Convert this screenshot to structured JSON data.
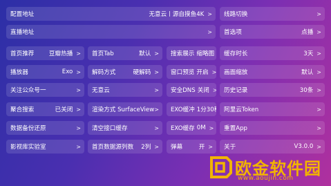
{
  "rows": [
    [
      {
        "name": "config-address",
        "label": "配置地址",
        "value": "无意云丨源自摸鱼4K"
      },
      {
        "name": "line-switch",
        "label": "线路切换",
        "value": ""
      }
    ],
    [
      {
        "name": "live-address",
        "label": "直播地址",
        "value": ""
      },
      {
        "name": "preferences",
        "label": "首选项",
        "value": "点播"
      }
    ],
    [
      {
        "name": "home-recommend",
        "label": "首页推荐",
        "value": "豆瓣热播"
      },
      {
        "name": "home-tab",
        "label": "首页Tab",
        "value": "默认"
      },
      {
        "name": "search-display",
        "label": "搜索展示",
        "value": "缩略图"
      },
      {
        "name": "cache-duration",
        "label": "缓存时长",
        "value": "3天"
      }
    ],
    [
      {
        "name": "player",
        "label": "播放器",
        "value": "Exo"
      },
      {
        "name": "decode-mode",
        "label": "解码方式",
        "value": "硬解码"
      },
      {
        "name": "window-preview",
        "label": "窗口预览",
        "value": "开启"
      },
      {
        "name": "picture-scale",
        "label": "画面缩放",
        "value": "默认"
      }
    ],
    [
      {
        "name": "follow-account",
        "label": "关注公众号一",
        "value": ""
      },
      {
        "name": "wuyiyun",
        "label": "无意云",
        "value": ""
      },
      {
        "name": "secure-dns",
        "label": "安全DNS",
        "value": "关闭"
      },
      {
        "name": "history",
        "label": "历史记录",
        "value": "30条"
      }
    ],
    [
      {
        "name": "aggregate-search",
        "label": "聚合搜索",
        "value": "已关闭"
      },
      {
        "name": "render-mode",
        "label": "渲染方式 SurfaceView",
        "value": ""
      },
      {
        "name": "exo-buffer",
        "label": "EXO缓冲",
        "value": "1分30秒"
      },
      {
        "name": "aliyun-token",
        "label": "阿里云Token",
        "value": ""
      }
    ],
    [
      {
        "name": "data-backup",
        "label": "数据备份还原",
        "value": ""
      },
      {
        "name": "clear-cache",
        "label": "清空接口缓存",
        "value": ""
      },
      {
        "name": "exo-cache",
        "label": "EXO缓存",
        "value": "0M"
      },
      {
        "name": "restart-app",
        "label": "重置App",
        "value": ""
      }
    ],
    [
      {
        "name": "video-lab",
        "label": "影视库实验室",
        "value": ""
      },
      {
        "name": "home-columns",
        "label": "首页数据源列数",
        "value": "2列"
      },
      {
        "name": "danmaku",
        "label": "弹幕",
        "value": "开"
      },
      {
        "name": "about",
        "label": "关于",
        "value": "V3.0.0"
      }
    ]
  ],
  "arrow": ">",
  "watermark": {
    "title": "欧金软件园",
    "url": "www.aoujin.com",
    "color": "#f2b400"
  },
  "colors": {
    "background_start": "#2c2fa6",
    "background_end": "#b0309e"
  }
}
